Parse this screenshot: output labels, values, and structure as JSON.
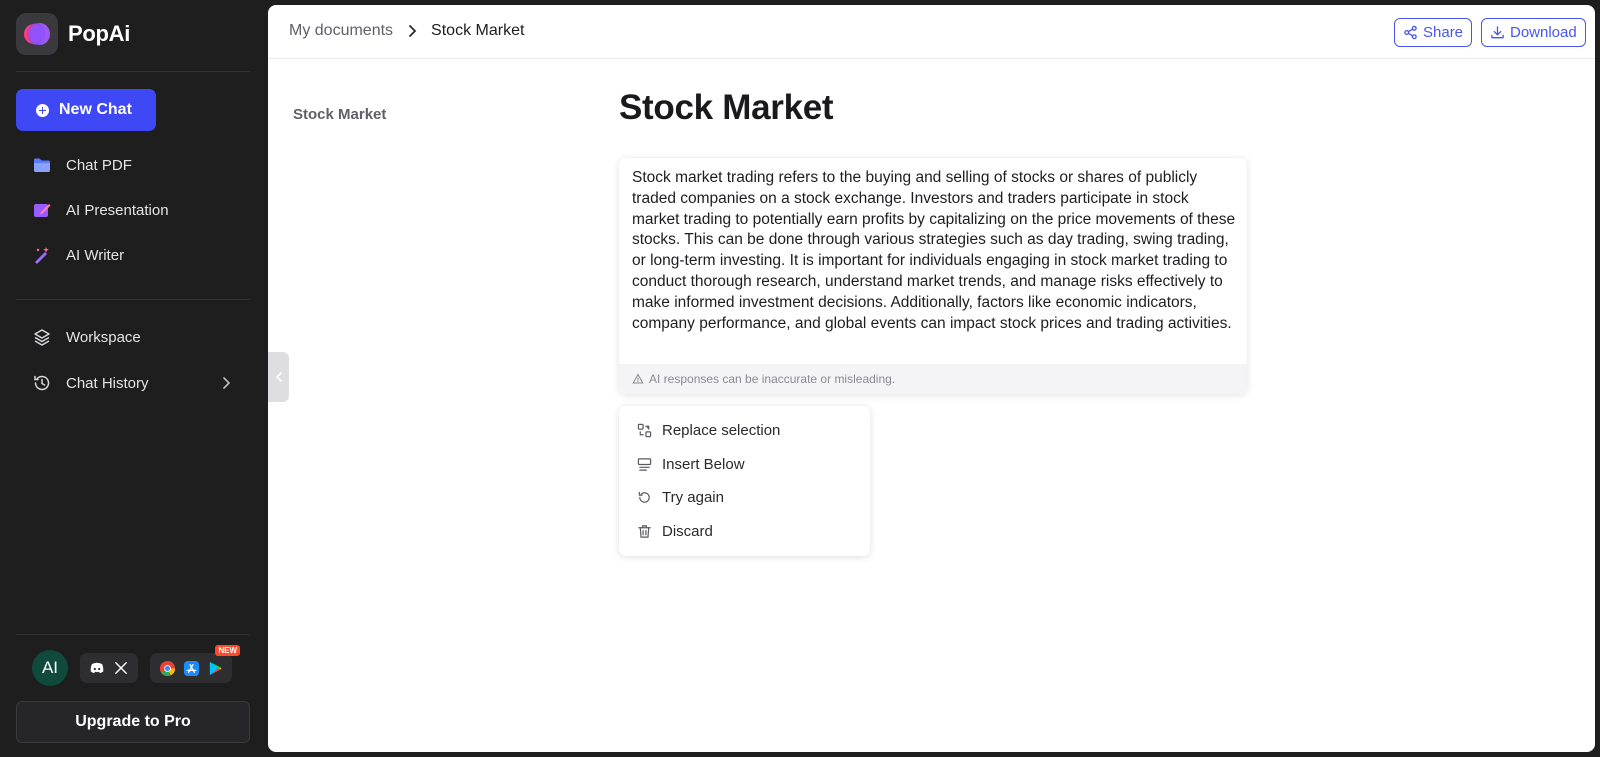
{
  "app": {
    "name": "PopAi"
  },
  "sidebar": {
    "new_chat_label": "New Chat",
    "items": [
      {
        "label": "Chat PDF",
        "icon": "folder-icon"
      },
      {
        "label": "AI Presentation",
        "icon": "presentation-pen-icon"
      },
      {
        "label": "AI Writer",
        "icon": "magic-wand-icon"
      },
      {
        "label": "Workspace",
        "icon": "layers-icon"
      },
      {
        "label": "Chat History",
        "icon": "history-icon"
      }
    ],
    "avatar_initials": "AI",
    "new_badge": "NEW",
    "upgrade_label": "Upgrade to Pro"
  },
  "header": {
    "breadcrumb_root": "My documents",
    "breadcrumb_current": "Stock Market",
    "share_label": "Share",
    "download_label": "Download"
  },
  "outline": {
    "title": "Stock Market"
  },
  "document": {
    "title": "Stock Market",
    "ai_response": "Stock market trading refers to the buying and selling of stocks or shares of publicly traded companies on a stock exchange. Investors and traders participate in stock market trading to potentially earn profits by capitalizing on the price movements of these stocks. This can be done through various strategies such as day trading, swing trading, or long-term investing. It is important for individuals engaging in stock market trading to conduct thorough research, understand market trends, and manage risks effectively to make informed investment decisions. Additionally, factors like economic indicators, company performance, and global events can impact stock prices and trading activities.",
    "disclaimer": "AI responses can be inaccurate or misleading."
  },
  "actions_menu": {
    "items": [
      {
        "label": "Replace selection",
        "icon": "replace-icon"
      },
      {
        "label": "Insert Below",
        "icon": "insert-below-icon"
      },
      {
        "label": "Try again",
        "icon": "retry-icon"
      },
      {
        "label": "Discard",
        "icon": "trash-icon"
      }
    ]
  },
  "colors": {
    "accent": "#3f48f5",
    "sidebar_bg": "#1e1e1f",
    "button_outline": "#4a55f0"
  }
}
